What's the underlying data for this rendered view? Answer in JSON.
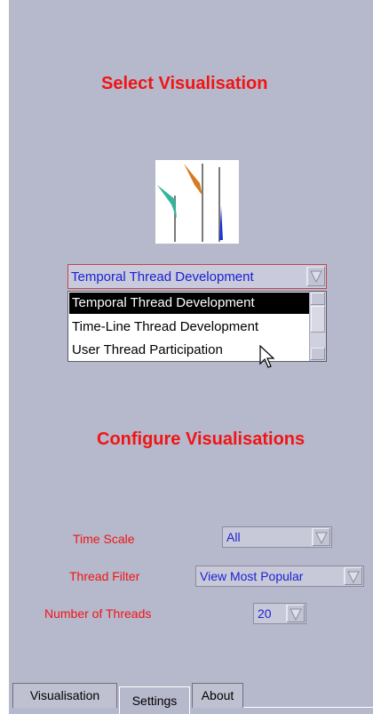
{
  "headings": {
    "select": "Select Visualisation",
    "configure": "Configure Visualisations"
  },
  "visualisation": {
    "selected": "Temporal Thread Development",
    "options": [
      "Temporal Thread Development",
      "Time-Line Thread Development",
      "User Thread Participation"
    ],
    "highlighted_index": 0
  },
  "settings": {
    "time_scale": {
      "label": "Time Scale",
      "value": "All"
    },
    "thread_filter": {
      "label": "Thread Filter",
      "value": "View Most Popular"
    },
    "num_threads": {
      "label": "Number of Threads",
      "value": "20"
    }
  },
  "tabs": [
    {
      "label": "Visualisation",
      "active": false
    },
    {
      "label": "Settings",
      "active": true
    },
    {
      "label": "About",
      "active": false
    }
  ],
  "colors": {
    "panel_bg": "#b6b8cb",
    "heading": "#f01515",
    "combo_text": "#1a22d4",
    "selection_bg": "#000000"
  },
  "icons": {
    "thumbnail": "thread-visualisation-preview",
    "combo_arrow": "triangle-down-icon",
    "cursor": "mouse-pointer-icon"
  }
}
